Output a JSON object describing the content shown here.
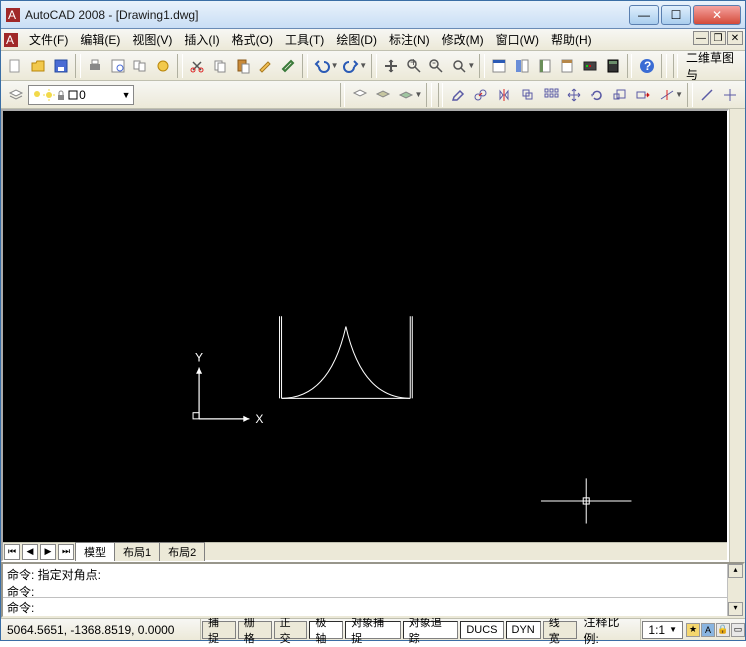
{
  "title": "AutoCAD 2008 - [Drawing1.dwg]",
  "menus": [
    "文件(F)",
    "编辑(E)",
    "视图(V)",
    "插入(I)",
    "格式(O)",
    "工具(T)",
    "绘图(D)",
    "标注(N)",
    "修改(M)",
    "窗口(W)",
    "帮助(H)"
  ],
  "toolbar_right_text": "二维草图与",
  "layer": {
    "current": "0"
  },
  "tabs": {
    "model": "模型",
    "layout1": "布局1",
    "layout2": "布局2"
  },
  "command": {
    "line1": "命令: 指定对角点:",
    "line2": "命令:",
    "prompt": "命令:"
  },
  "status": {
    "coords": "5064.5651, -1368.8519, 0.0000",
    "snap": "捕捉",
    "grid": "栅格",
    "ortho": "正交",
    "polar": "极轴",
    "osnap": "对象捕捉",
    "otrack": "对象追踪",
    "ducs": "DUCS",
    "dyn": "DYN",
    "lwt": "线宽",
    "annoscale_label": "注释比例:",
    "annoscale_value": "1:1"
  }
}
